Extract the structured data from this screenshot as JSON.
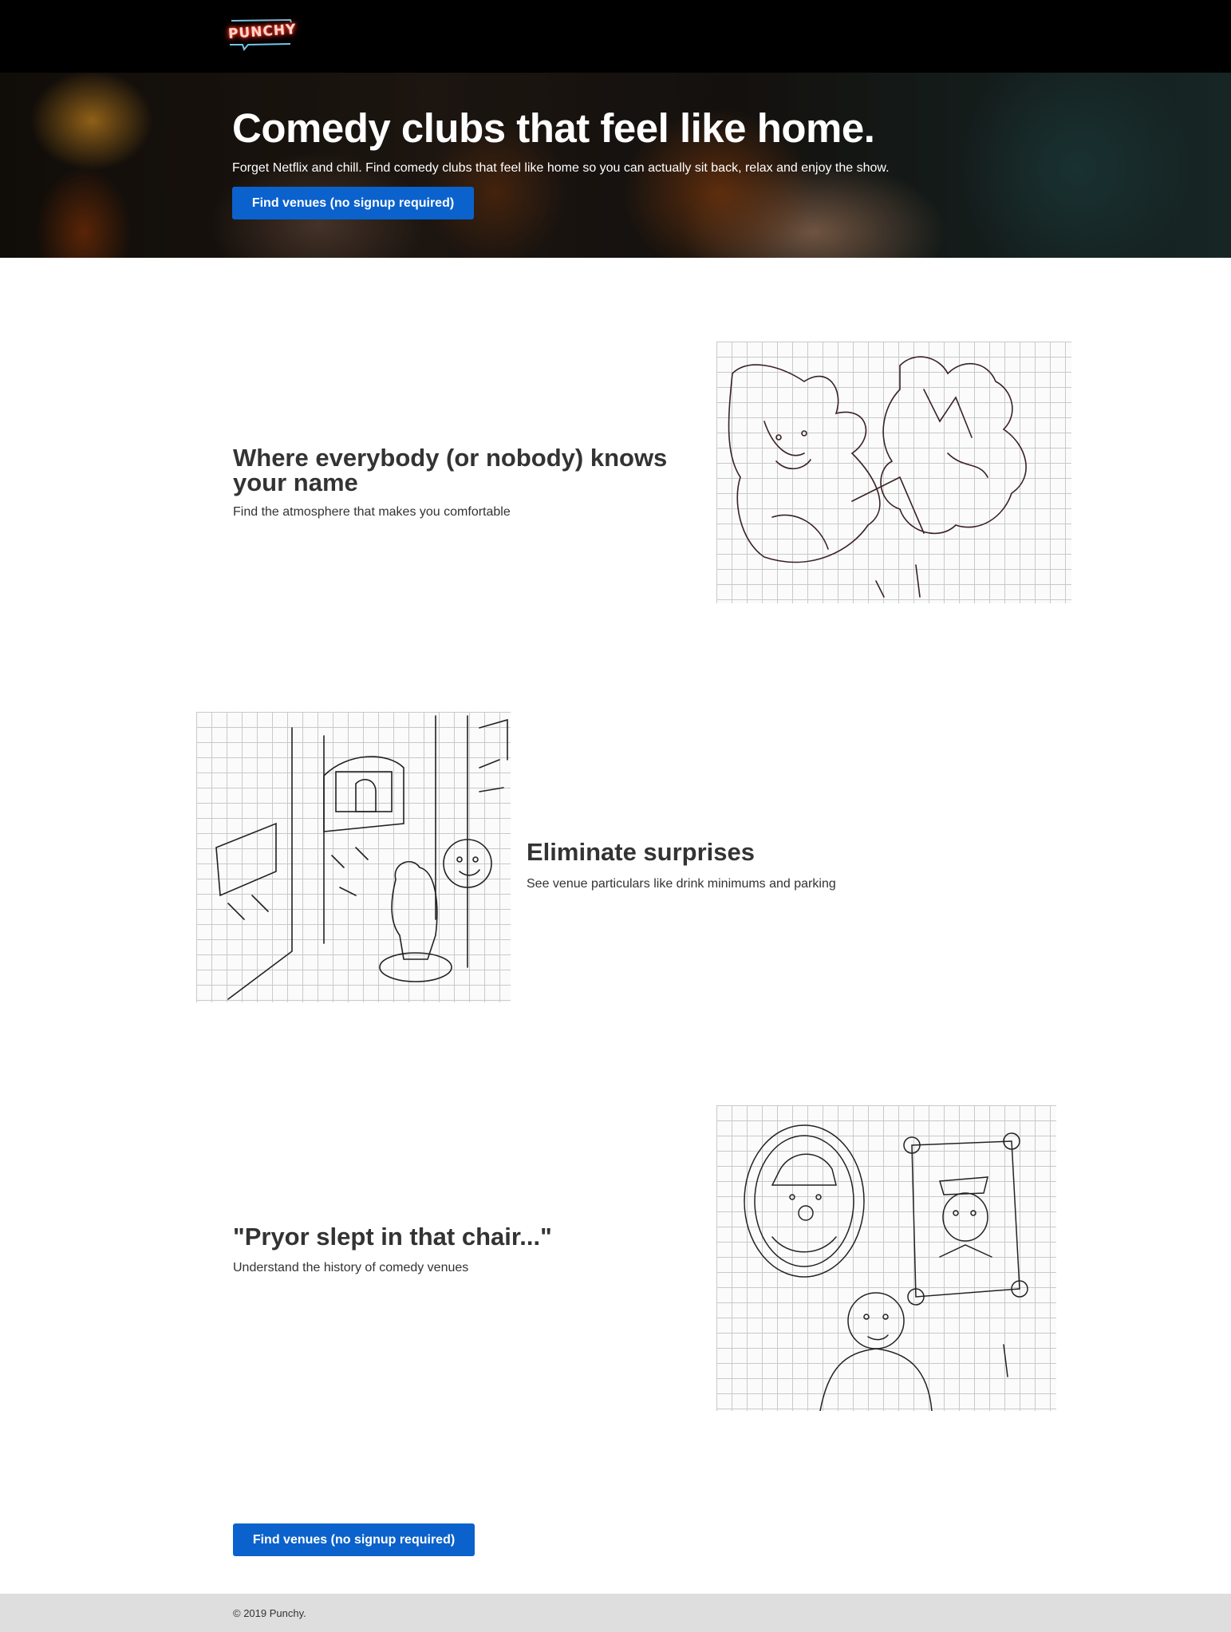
{
  "header": {
    "logo_text": "PUNCHY",
    "logo_icon": "neon-speech-bubble-logo"
  },
  "hero": {
    "title": "Comedy clubs that feel like home.",
    "subtitle": "Forget Netflix and chill. Find comedy clubs that feel like home so you can actually sit back, relax and enjoy the show.",
    "cta_label": "Find venues (no signup required)"
  },
  "features": [
    {
      "title": "Where everybody (or nobody) knows your name",
      "text": "Find the atmosphere that makes you comfortable",
      "image": "puzzle-pieces-sketch"
    },
    {
      "title": "Eliminate surprises",
      "text": "See venue particulars like drink minimums and parking",
      "image": "venue-entrance-sketch"
    },
    {
      "title": "\"Pryor slept in that chair...\"",
      "text": "Understand the history of comedy venues",
      "image": "comedian-portraits-sketch"
    }
  ],
  "bottom_cta_label": "Find venues (no signup required)",
  "footer": {
    "copyright": "© 2019 Punchy."
  },
  "colors": {
    "primary_button": "#0b62cc",
    "header_bg": "#000000",
    "footer_bg": "#dedede",
    "text": "#333333"
  }
}
